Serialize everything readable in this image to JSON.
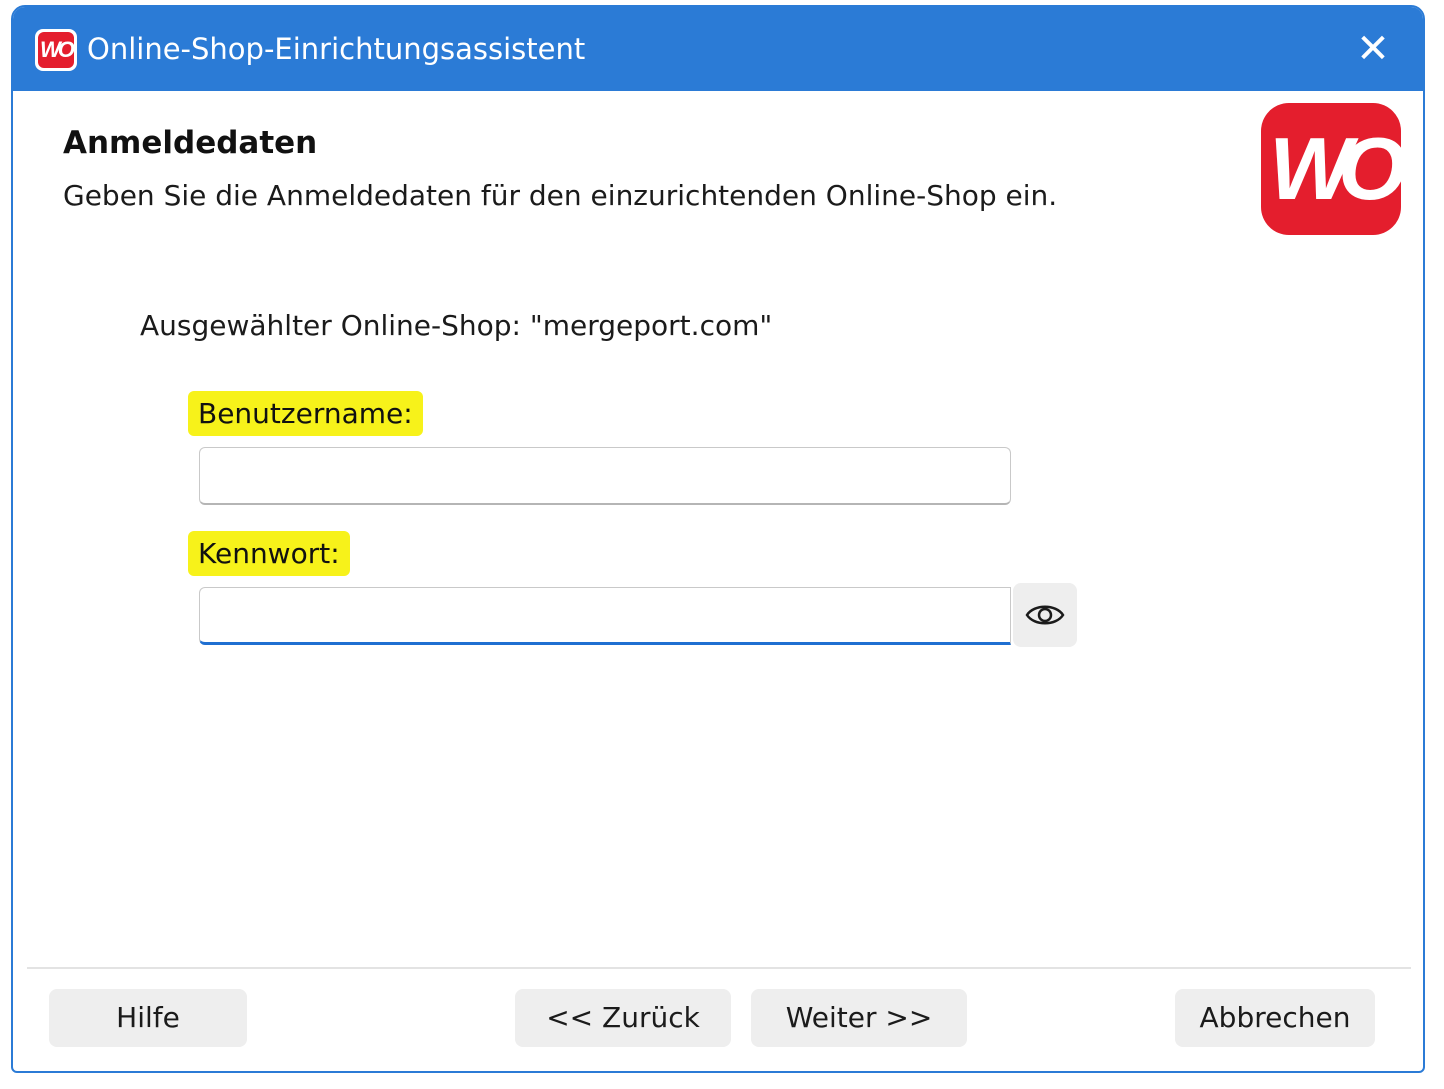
{
  "window": {
    "title": "Online-Shop-Einrichtungsassistent",
    "logo_text": "WO",
    "close_glyph": "✕"
  },
  "header": {
    "heading": "Anmeldedaten",
    "subheading": "Geben Sie die Anmeldedaten für den einzurichtenden Online-Shop ein.",
    "logo_text": "WO"
  },
  "form": {
    "selected_shop_text": "Ausgewählter Online-Shop: \"mergeport.com\"",
    "username_label": "Benutzername:",
    "username_value": "",
    "password_label": "Kennwort:",
    "password_value": ""
  },
  "buttons": {
    "help": "Hilfe",
    "back": "<< Zurück",
    "next": "Weiter >>",
    "cancel": "Abbrechen"
  },
  "colors": {
    "titlebar": "#2b7bd6",
    "brand_red": "#e41e2d",
    "highlight": "#f7f21a",
    "focus_blue": "#1f6fd1"
  },
  "icons": {
    "app_logo": "wo-logo-icon",
    "close": "close-icon",
    "show_password": "eye-icon"
  }
}
